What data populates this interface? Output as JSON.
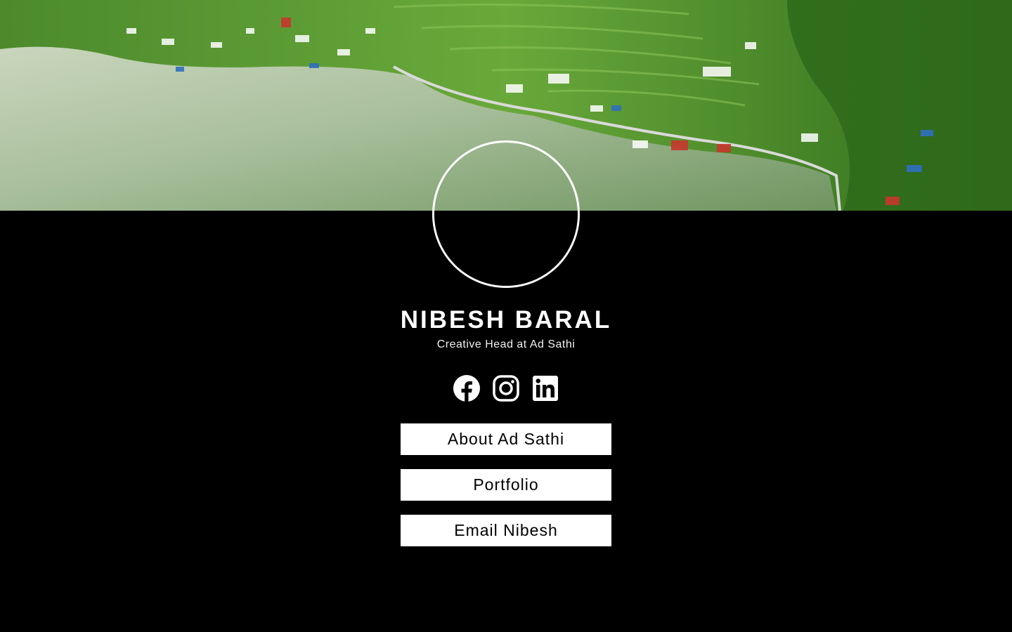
{
  "profile": {
    "name": "NIBESH BARAL",
    "title": "Creative Head at Ad Sathi"
  },
  "socials": [
    {
      "icon": "facebook-icon"
    },
    {
      "icon": "instagram-icon"
    },
    {
      "icon": "linkedin-icon"
    }
  ],
  "links": [
    {
      "label": "About Ad Sathi"
    },
    {
      "label": "Portfolio"
    },
    {
      "label": "Email Nibesh"
    }
  ],
  "colors": {
    "background": "#000000",
    "button_bg": "#ffffff",
    "button_text": "#000000",
    "text": "#ffffff",
    "lake": "#9fb894",
    "hills": "#4f8f2a"
  }
}
